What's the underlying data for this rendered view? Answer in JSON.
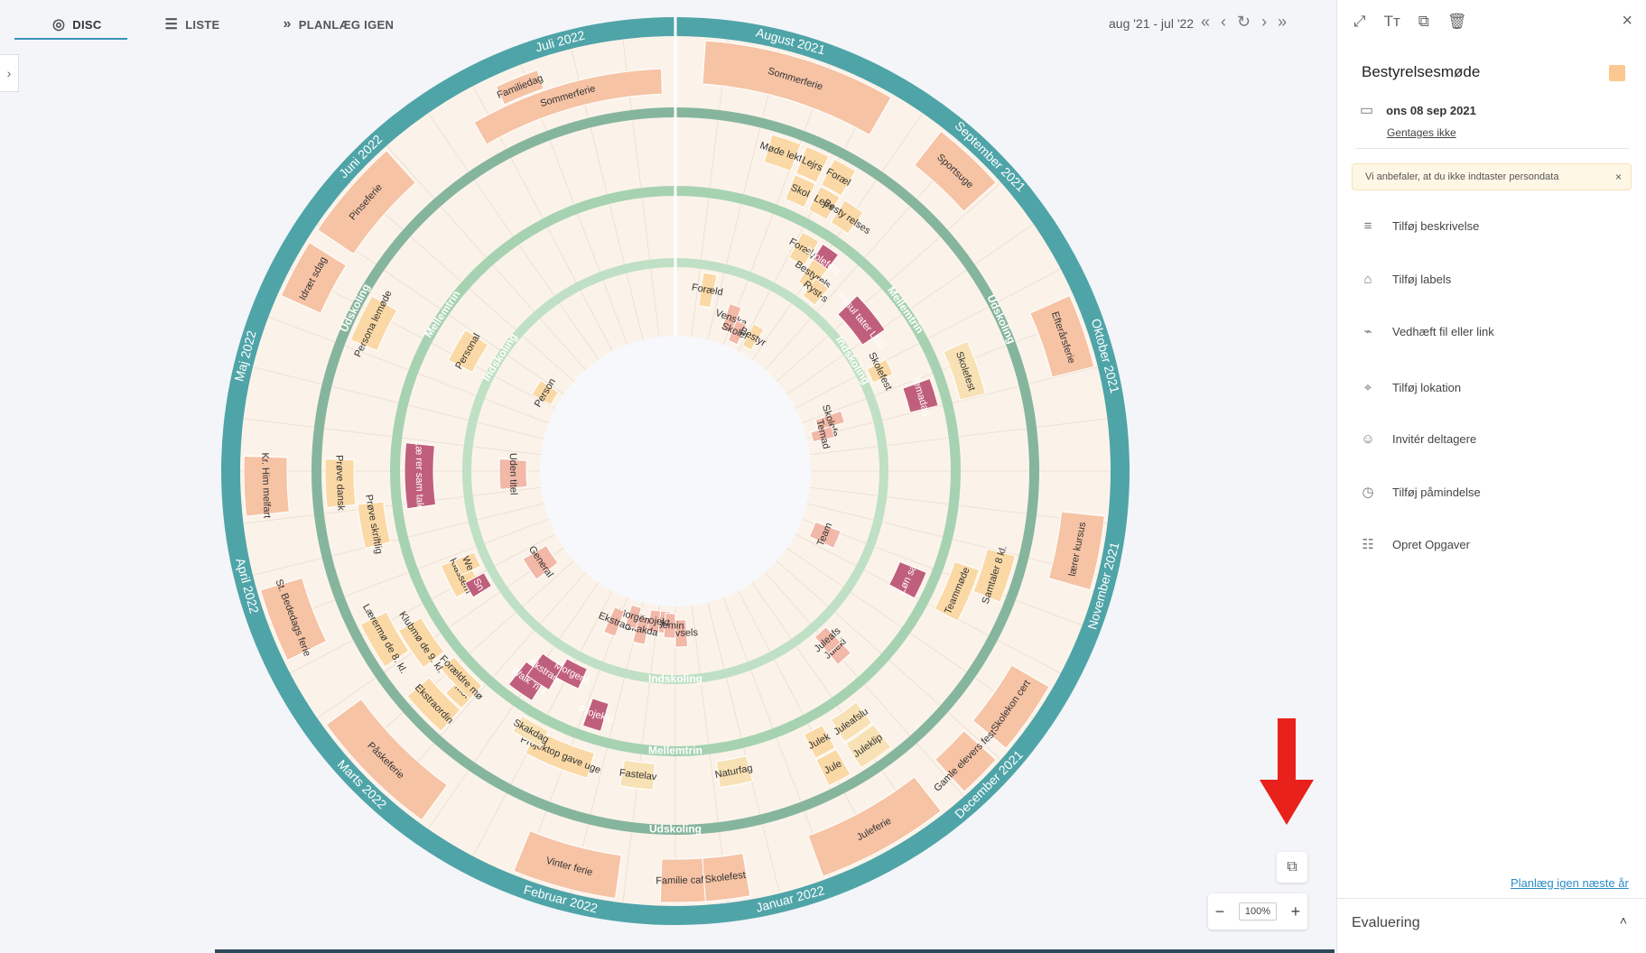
{
  "tabs": [
    {
      "label": "DISC",
      "icon": "disc-icon"
    },
    {
      "label": "LISTE",
      "icon": "list-icon"
    },
    {
      "label": "PLANLÆG IGEN",
      "icon": "double-chevron-icon"
    }
  ],
  "range": "aug '21 - jul '22",
  "colors": {
    "outer": "#4fa4a8",
    "band1": "#86b59d",
    "band2": "#a6d2b2",
    "band3": "#bfe0c4",
    "bg": "#fbf3ea",
    "peach": "#f6c3a5",
    "orange": "#fbd9a6",
    "pink": "#f2b8a8",
    "magenta": "#c05f7c",
    "yellow": "#f8e2b5"
  },
  "months": [
    "August 2021",
    "September 2021",
    "Oktober 2021",
    "November 2021",
    "December 2021",
    "Januar 2022",
    "Februar 2022",
    "Marts 2022",
    "April 2022",
    "Maj 2022",
    "Juni 2022",
    "Juli 2022"
  ],
  "rings": [
    {
      "name": "Udskoling",
      "labels": [
        {
          "text": "Udskoling",
          "deg": 65
        },
        {
          "text": "Udskoling",
          "deg": 180
        },
        {
          "text": "Udskoling",
          "deg": 297
        }
      ]
    },
    {
      "name": "Mellemtrin",
      "labels": [
        {
          "text": "Mellemtrin",
          "deg": 55
        },
        {
          "text": "Mellemtrin",
          "deg": 180
        },
        {
          "text": "Mellemtrin",
          "deg": 304
        }
      ]
    },
    {
      "name": "Indskoling",
      "labels": [
        {
          "text": "Indskoling",
          "deg": 58
        },
        {
          "text": "Indskoling",
          "deg": 180
        },
        {
          "text": "Indskoling",
          "deg": 303
        }
      ]
    }
  ],
  "events": [
    {
      "text": "Sommerferie",
      "lane": 0,
      "a": 4,
      "b": 30,
      "c": "peach"
    },
    {
      "text": "Sportsuge",
      "lane": 0,
      "a": 38,
      "b": 48,
      "c": "peach"
    },
    {
      "text": "Efterårsferie",
      "lane": 0,
      "a": 66,
      "b": 76,
      "c": "peach"
    },
    {
      "text": "lærer kursus",
      "lane": 0,
      "a": 96,
      "b": 106,
      "c": "peach"
    },
    {
      "text": "Skolekon cert",
      "lane": 0,
      "a": 120,
      "b": 130,
      "c": "peach"
    },
    {
      "text": "Gamle elevers fest",
      "lane": 0,
      "a": 132,
      "b": 138,
      "c": "peach"
    },
    {
      "text": "Juleferie",
      "lane": 0,
      "a": 142,
      "b": 160,
      "c": "peach"
    },
    {
      "text": "Familie café",
      "lane": 0,
      "a": 176,
      "b": 182,
      "c": "peach"
    },
    {
      "text": "Skolefest",
      "lane": 0,
      "a": 170,
      "b": 176,
      "c": "peach"
    },
    {
      "text": "Vinter ferie",
      "lane": 0,
      "a": 188,
      "b": 202,
      "c": "peach"
    },
    {
      "text": "Påskeferie",
      "lane": 0,
      "a": 216,
      "b": 234,
      "c": "peach"
    },
    {
      "text": "St. Bededags ferie",
      "lane": 0,
      "a": 244,
      "b": 254,
      "c": "peach"
    },
    {
      "text": "Kr. Him melfart",
      "lane": 0,
      "a": 264,
      "b": 272,
      "c": "peach"
    },
    {
      "text": "Idræt sdag",
      "lane": 0,
      "a": 294,
      "b": 302,
      "c": "peach"
    },
    {
      "text": "Pinseferie",
      "lane": 0,
      "a": 304,
      "b": 318,
      "c": "peach"
    },
    {
      "text": "Familiedag",
      "lane": 1,
      "a": 335,
      "b": 341,
      "c": "peach"
    },
    {
      "text": "Sommerferie",
      "lane": 2,
      "a": 330,
      "b": 358,
      "c": "peach"
    },
    {
      "text": "Møde lekti",
      "lane": 3,
      "a": 16,
      "b": 21,
      "c": "orange"
    },
    {
      "text": "Lejrs",
      "lane": 3,
      "a": 22,
      "b": 26,
      "c": "orange"
    },
    {
      "text": "Foræl",
      "lane": 3,
      "a": 27,
      "b": 31,
      "c": "orange"
    },
    {
      "text": "Skol",
      "lane": 4,
      "a": 22,
      "b": 26,
      "c": "orange"
    },
    {
      "text": "Lejrs",
      "lane": 4,
      "a": 27,
      "b": 31,
      "c": "orange"
    },
    {
      "text": "Besty relses",
      "lane": 4,
      "a": 32,
      "b": 36,
      "c": "orange"
    },
    {
      "text": "Skolefest",
      "lane": 4,
      "a": 66,
      "b": 76,
      "c": "yellow"
    },
    {
      "text": "Samtaler 8 kl.",
      "lane": 3,
      "a": 104,
      "b": 112,
      "c": "orange"
    },
    {
      "text": "Teammøde",
      "lane": 4,
      "a": 108,
      "b": 118,
      "c": "orange"
    },
    {
      "text": "Juleklip",
      "lane": 3,
      "a": 142,
      "b": 148,
      "c": "yellow"
    },
    {
      "text": "Juleafslu",
      "lane": 4,
      "a": 142,
      "b": 148,
      "c": "yellow"
    },
    {
      "text": "Jule",
      "lane": 3,
      "a": 150,
      "b": 154,
      "c": "orange"
    },
    {
      "text": "Julek",
      "lane": 4,
      "a": 150,
      "b": 154,
      "c": "orange"
    },
    {
      "text": "Naturfag",
      "lane": 4,
      "a": 166,
      "b": 172,
      "c": "yellow"
    },
    {
      "text": "Fastelav",
      "lane": 4,
      "a": 184,
      "b": 190,
      "c": "yellow"
    },
    {
      "text": "Projektop gave uge",
      "lane": 4,
      "a": 196,
      "b": 208,
      "c": "orange"
    },
    {
      "text": "Skakdag",
      "lane": 5,
      "a": 206,
      "b": 212,
      "c": "yellow"
    },
    {
      "text": "Ekstraordin",
      "lane": 3,
      "a": 222,
      "b": 230,
      "c": "orange"
    },
    {
      "text": "Mor",
      "lane": 4,
      "a": 222,
      "b": 226,
      "c": "orange"
    },
    {
      "text": "Forældre mø",
      "lane": 5,
      "a": 222,
      "b": 230,
      "c": "orange"
    },
    {
      "text": "Lærermø de 8. kl.",
      "lane": 3,
      "a": 236,
      "b": 244,
      "c": "orange"
    },
    {
      "text": "Klubmø de 9. kl.",
      "lane": 4,
      "a": 232,
      "b": 240,
      "c": "orange"
    },
    {
      "text": "Prøve dansk",
      "lane": 3,
      "a": 264,
      "b": 272,
      "c": "orange"
    },
    {
      "text": "Prøve skriftlig",
      "lane": 4,
      "a": 256,
      "b": 264,
      "c": "orange"
    },
    {
      "text": "Persona lemøde",
      "lane": 3,
      "a": 292,
      "b": 300,
      "c": "orange"
    },
    {
      "text": "Forælд",
      "lane": 6,
      "a": 28,
      "b": 32,
      "c": "orange"
    },
    {
      "text": "Skolefotg",
      "lane": 6,
      "a": 33,
      "b": 37,
      "c": "magenta"
    },
    {
      "text": "Bestyrels",
      "lane": 7,
      "a": 33,
      "b": 37,
      "c": "orange"
    },
    {
      "text": "Ryst-s",
      "lane": 8,
      "a": 36,
      "b": 40,
      "c": "orange"
    },
    {
      "text": "Resul tater LUS",
      "lane": 7,
      "a": 46,
      "b": 56,
      "c": "magenta"
    },
    {
      "text": "Skolefest",
      "lane": 8,
      "a": 62,
      "b": 66,
      "c": "orange"
    },
    {
      "text": "Temadag",
      "lane": 6,
      "a": 70,
      "b": 76,
      "c": "magenta"
    },
    {
      "text": "Løn sa",
      "lane": 6,
      "a": 112,
      "b": 118,
      "c": "magenta"
    },
    {
      "text": "Juleki",
      "lane": 7,
      "a": 136,
      "b": 140,
      "c": "pink"
    },
    {
      "text": "Julеafs",
      "lane": 8,
      "a": 136,
      "b": 140,
      "c": "pink"
    },
    {
      "text": "Walk 'n' t",
      "lane": 6,
      "a": 212,
      "b": 218,
      "c": "magenta"
    },
    {
      "text": "Ekstraor",
      "lane": 7,
      "a": 210,
      "b": 216,
      "c": "magenta"
    },
    {
      "text": "Morgens",
      "lane": 8,
      "a": 204,
      "b": 210,
      "c": "magenta"
    },
    {
      "text": "Projekto",
      "lane": 6,
      "a": 196,
      "b": 200,
      "c": "magenta"
    },
    {
      "text": "Klassem",
      "lane": 7,
      "a": 240,
      "b": 248,
      "c": "orange"
    },
    {
      "text": "Sn",
      "lane": 8,
      "a": 238,
      "b": 242,
      "c": "magenta"
    },
    {
      "text": "We",
      "lane": 8,
      "a": 244,
      "b": 248,
      "c": "orange"
    },
    {
      "text": "Læ rer sam tale",
      "lane": 6,
      "a": 262,
      "b": 276,
      "c": "magenta"
    },
    {
      "text": "Personal",
      "lane": 7,
      "a": 296,
      "b": 304,
      "c": "orange"
    },
    {
      "text": "Foræld",
      "lane": 9,
      "a": 8,
      "b": 12,
      "c": "orange"
    },
    {
      "text": "Venska",
      "lane": 10,
      "a": 18,
      "b": 22,
      "c": "pink"
    },
    {
      "text": "Skolefo",
      "lane": 11,
      "a": 22,
      "b": 26,
      "c": "pink"
    },
    {
      "text": "Bestyr",
      "lane": 12,
      "a": 28,
      "b": 32,
      "c": "orange"
    },
    {
      "text": "Skolefe",
      "lane": 10,
      "a": 70,
      "b": 74,
      "c": "pink"
    },
    {
      "text": "Temad",
      "lane": 11,
      "a": 74,
      "b": 78,
      "c": "pink"
    },
    {
      "text": "Team",
      "lane": 10,
      "a": 110,
      "b": 116,
      "c": "pink"
    },
    {
      "text": "Trivsels",
      "lane": 10,
      "a": 176,
      "b": 180,
      "c": "pink"
    },
    {
      "text": "Fast",
      "lane": 11,
      "a": 182,
      "b": 186,
      "c": "pink"
    },
    {
      "text": "Semin",
      "lane": 12,
      "a": 180,
      "b": 184,
      "c": "pink"
    },
    {
      "text": "Projekt",
      "lane": 11,
      "a": 186,
      "b": 190,
      "c": "pink"
    },
    {
      "text": "Skakda",
      "lane": 10,
      "a": 190,
      "b": 194,
      "c": "pink"
    },
    {
      "text": "Morgen",
      "lane": 11,
      "a": 194,
      "b": 198,
      "c": "pink"
    },
    {
      "text": "Ekstrao",
      "lane": 10,
      "a": 200,
      "b": 204,
      "c": "pink"
    },
    {
      "text": "General",
      "lane": 10,
      "a": 232,
      "b": 240,
      "c": "pink"
    },
    {
      "text": "Uden titel",
      "lane": 10,
      "a": 264,
      "b": 274,
      "c": "pink"
    },
    {
      "text": "Person",
      "lane": 11,
      "a": 298,
      "b": 304,
      "c": "orange"
    }
  ],
  "panel": {
    "title": "Bestyrelsesmøde",
    "date": "ons 08 sep 2021",
    "repeat": "Gentages ikke",
    "note": "Vi anbefaler, at du ikke indtaster persondata",
    "actions": [
      {
        "label": "Tilføj beskrivelse",
        "icon": "text-lines-icon"
      },
      {
        "label": "Tilføj labels",
        "icon": "tag-icon"
      },
      {
        "label": "Vedhæft fil eller link",
        "icon": "paperclip-icon"
      },
      {
        "label": "Tilføj lokation",
        "icon": "location-pin-icon"
      },
      {
        "label": "Invitér deltagere",
        "icon": "person-icon"
      },
      {
        "label": "Tilføj påmindelse",
        "icon": "alarm-clock-icon"
      },
      {
        "label": "Opret Opgaver",
        "icon": "checklist-icon"
      }
    ],
    "replan": "Planlæg igen næste år",
    "evaluation": "Evaluering"
  },
  "zoom": "100%"
}
